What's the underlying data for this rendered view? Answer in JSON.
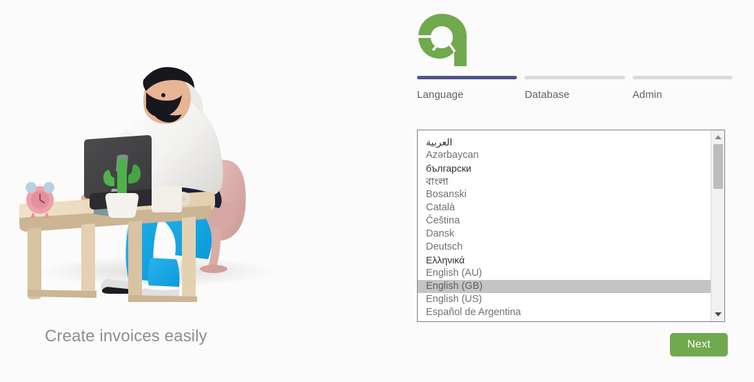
{
  "page": {
    "background_color": "#fbfbfb",
    "accent_green": "#70a94e",
    "accent_step_active": "#4f538c",
    "step_inactive": "#d7dade"
  },
  "left": {
    "illustration_name": "person-working-at-desk-illustration",
    "tagline": "Create invoices easily"
  },
  "brand": {
    "logo_name": "odoo-a-logo",
    "logo_color": "#70a94e"
  },
  "steps": [
    {
      "label": "Language",
      "active": true
    },
    {
      "label": "Database",
      "active": false
    },
    {
      "label": "Admin",
      "active": false
    }
  ],
  "language_list": {
    "selected": "English (GB)",
    "items": [
      {
        "label": "العربية",
        "nonlatin": true
      },
      {
        "label": "Azərbaycan",
        "nonlatin": false
      },
      {
        "label": "български",
        "nonlatin": true
      },
      {
        "label": "বাংলা",
        "nonlatin": true
      },
      {
        "label": "Bosanski",
        "nonlatin": false
      },
      {
        "label": "Català",
        "nonlatin": false
      },
      {
        "label": "Čeština",
        "nonlatin": false
      },
      {
        "label": "Dansk",
        "nonlatin": false
      },
      {
        "label": "Deutsch",
        "nonlatin": false
      },
      {
        "label": "Ελληνικά",
        "nonlatin": true
      },
      {
        "label": "English (AU)",
        "nonlatin": false
      },
      {
        "label": "English (GB)",
        "nonlatin": false
      },
      {
        "label": "English (US)",
        "nonlatin": false
      },
      {
        "label": "Español de Argentina",
        "nonlatin": false
      }
    ]
  },
  "scrollbar": {
    "up_arrow_name": "scroll-up-arrow",
    "down_arrow_name": "scroll-down-arrow"
  },
  "footer": {
    "next_label": "Next"
  }
}
